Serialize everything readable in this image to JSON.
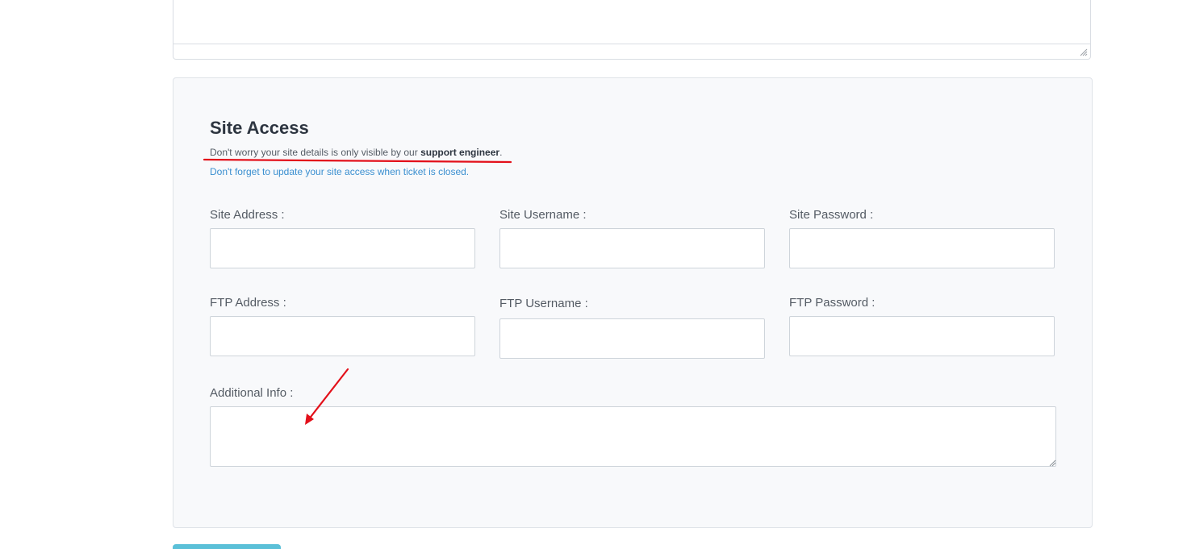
{
  "site_access": {
    "title": "Site Access",
    "note_prefix": "Don't worry your site details is only visible by our ",
    "note_bold": "support engineer",
    "note_suffix": ".",
    "hint": "Don't forget to update your site access when ticket is closed.",
    "fields": {
      "site_address_label": "Site Address :",
      "site_username_label": "Site Username :",
      "site_password_label": "Site Password :",
      "ftp_address_label": "FTP Address :",
      "ftp_username_label": "FTP Username :",
      "ftp_password_label": "FTP Password :",
      "additional_info_label": "Additional Info :"
    },
    "values": {
      "site_address": "",
      "site_username": "",
      "site_password": "",
      "ftp_address": "",
      "ftp_username": "",
      "ftp_password": "",
      "additional_info": ""
    }
  },
  "annotations": {
    "color": "#e3101a",
    "marks": [
      "underline",
      "arrow"
    ]
  },
  "colors": {
    "card_background": "#f8f9fb",
    "hint_text": "#3a8fd0",
    "submit_button": "#5bc0d8"
  }
}
